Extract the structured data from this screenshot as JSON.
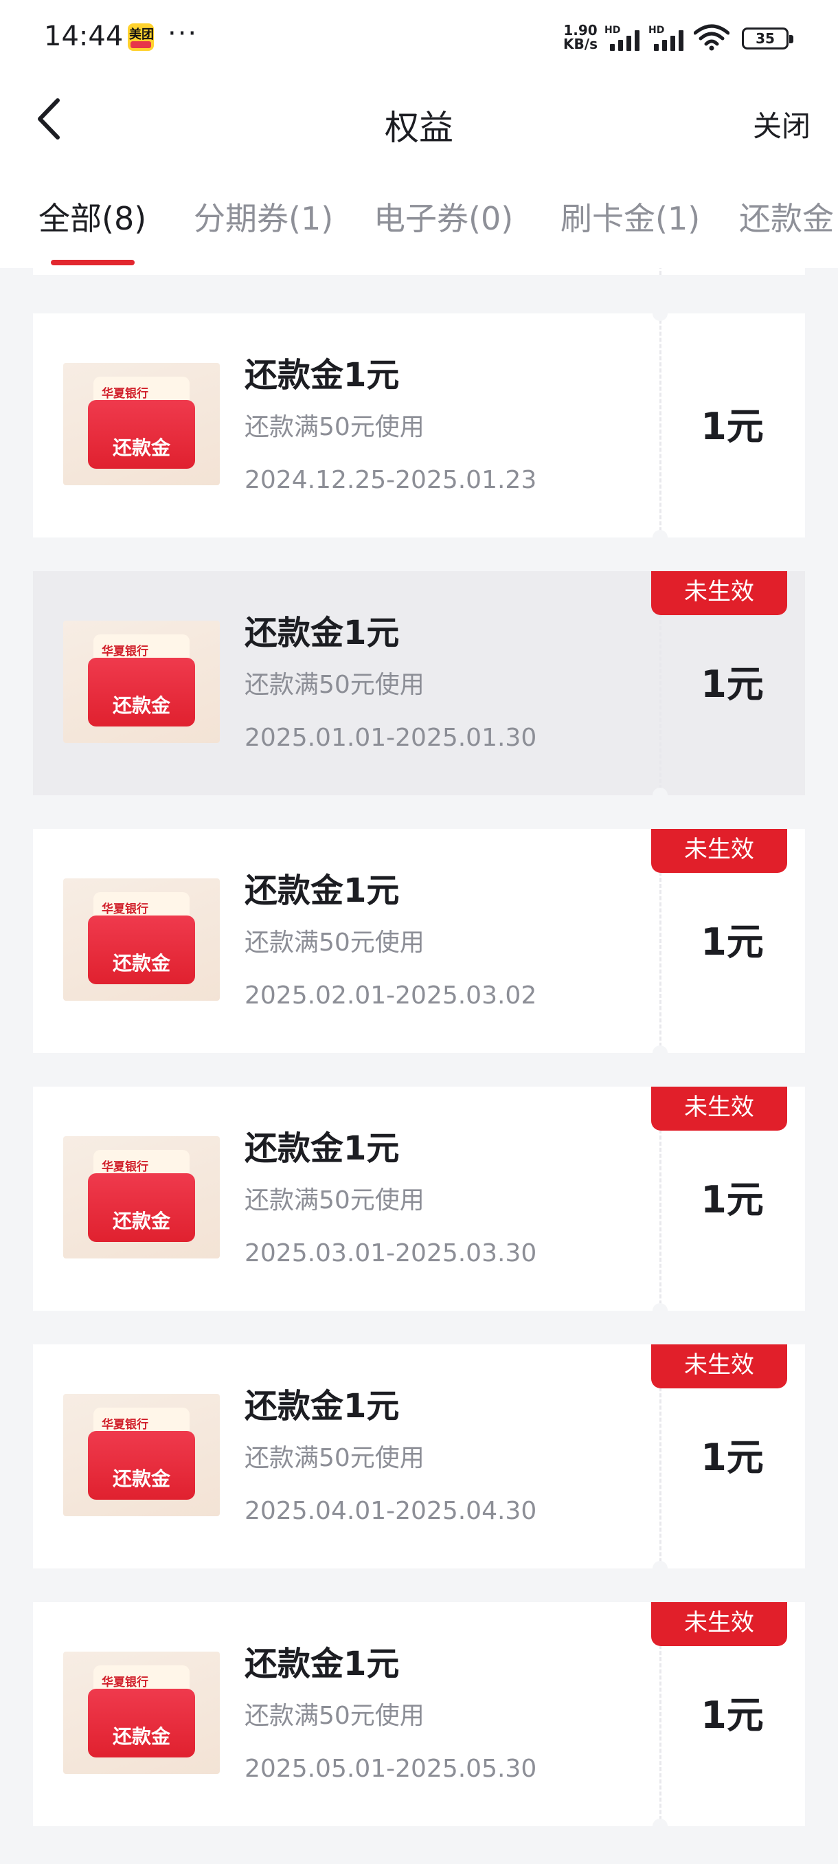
{
  "status_bar": {
    "time": "14:44",
    "app_badge": "美团",
    "more_dots": "···",
    "net_speed_value": "1.90",
    "net_speed_unit": "KB/s",
    "signal_1_label": "HD",
    "signal_2_label": "HD",
    "battery": "35"
  },
  "nav": {
    "title": "权益",
    "close_label": "关闭",
    "back_icon": "chevron-left-icon"
  },
  "tabs": [
    {
      "label": "全部(8)",
      "active": true
    },
    {
      "label": "分期券(1)",
      "active": false
    },
    {
      "label": "电子券(0)",
      "active": false
    },
    {
      "label": "刷卡金(1)",
      "active": false
    },
    {
      "label": "还款金",
      "active": false
    }
  ],
  "coupons": [
    {
      "title": "还款金1元",
      "desc": "还款满50元使用",
      "dates": "2024.12.25-2025.01.23",
      "amount": "1元",
      "badge": "",
      "bank": "华夏银行",
      "thumb_label": "还款金"
    },
    {
      "title": "还款金1元",
      "desc": "还款满50元使用",
      "dates": "2025.01.01-2025.01.30",
      "amount": "1元",
      "badge": "未生效",
      "bank": "华夏银行",
      "thumb_label": "还款金"
    },
    {
      "title": "还款金1元",
      "desc": "还款满50元使用",
      "dates": "2025.02.01-2025.03.02",
      "amount": "1元",
      "badge": "未生效",
      "bank": "华夏银行",
      "thumb_label": "还款金"
    },
    {
      "title": "还款金1元",
      "desc": "还款满50元使用",
      "dates": "2025.03.01-2025.03.30",
      "amount": "1元",
      "badge": "未生效",
      "bank": "华夏银行",
      "thumb_label": "还款金"
    },
    {
      "title": "还款金1元",
      "desc": "还款满50元使用",
      "dates": "2025.04.01-2025.04.30",
      "amount": "1元",
      "badge": "未生效",
      "bank": "华夏银行",
      "thumb_label": "还款金"
    },
    {
      "title": "还款金1元",
      "desc": "还款满50元使用",
      "dates": "2025.05.01-2025.05.30",
      "amount": "1元",
      "badge": "未生效",
      "bank": "华夏银行",
      "thumb_label": "还款金"
    }
  ],
  "colors": {
    "accent": "#e2272f",
    "badge_bg": "#e11f2a",
    "page_bg": "#f4f5f7",
    "dim_card_bg": "#ececef"
  }
}
